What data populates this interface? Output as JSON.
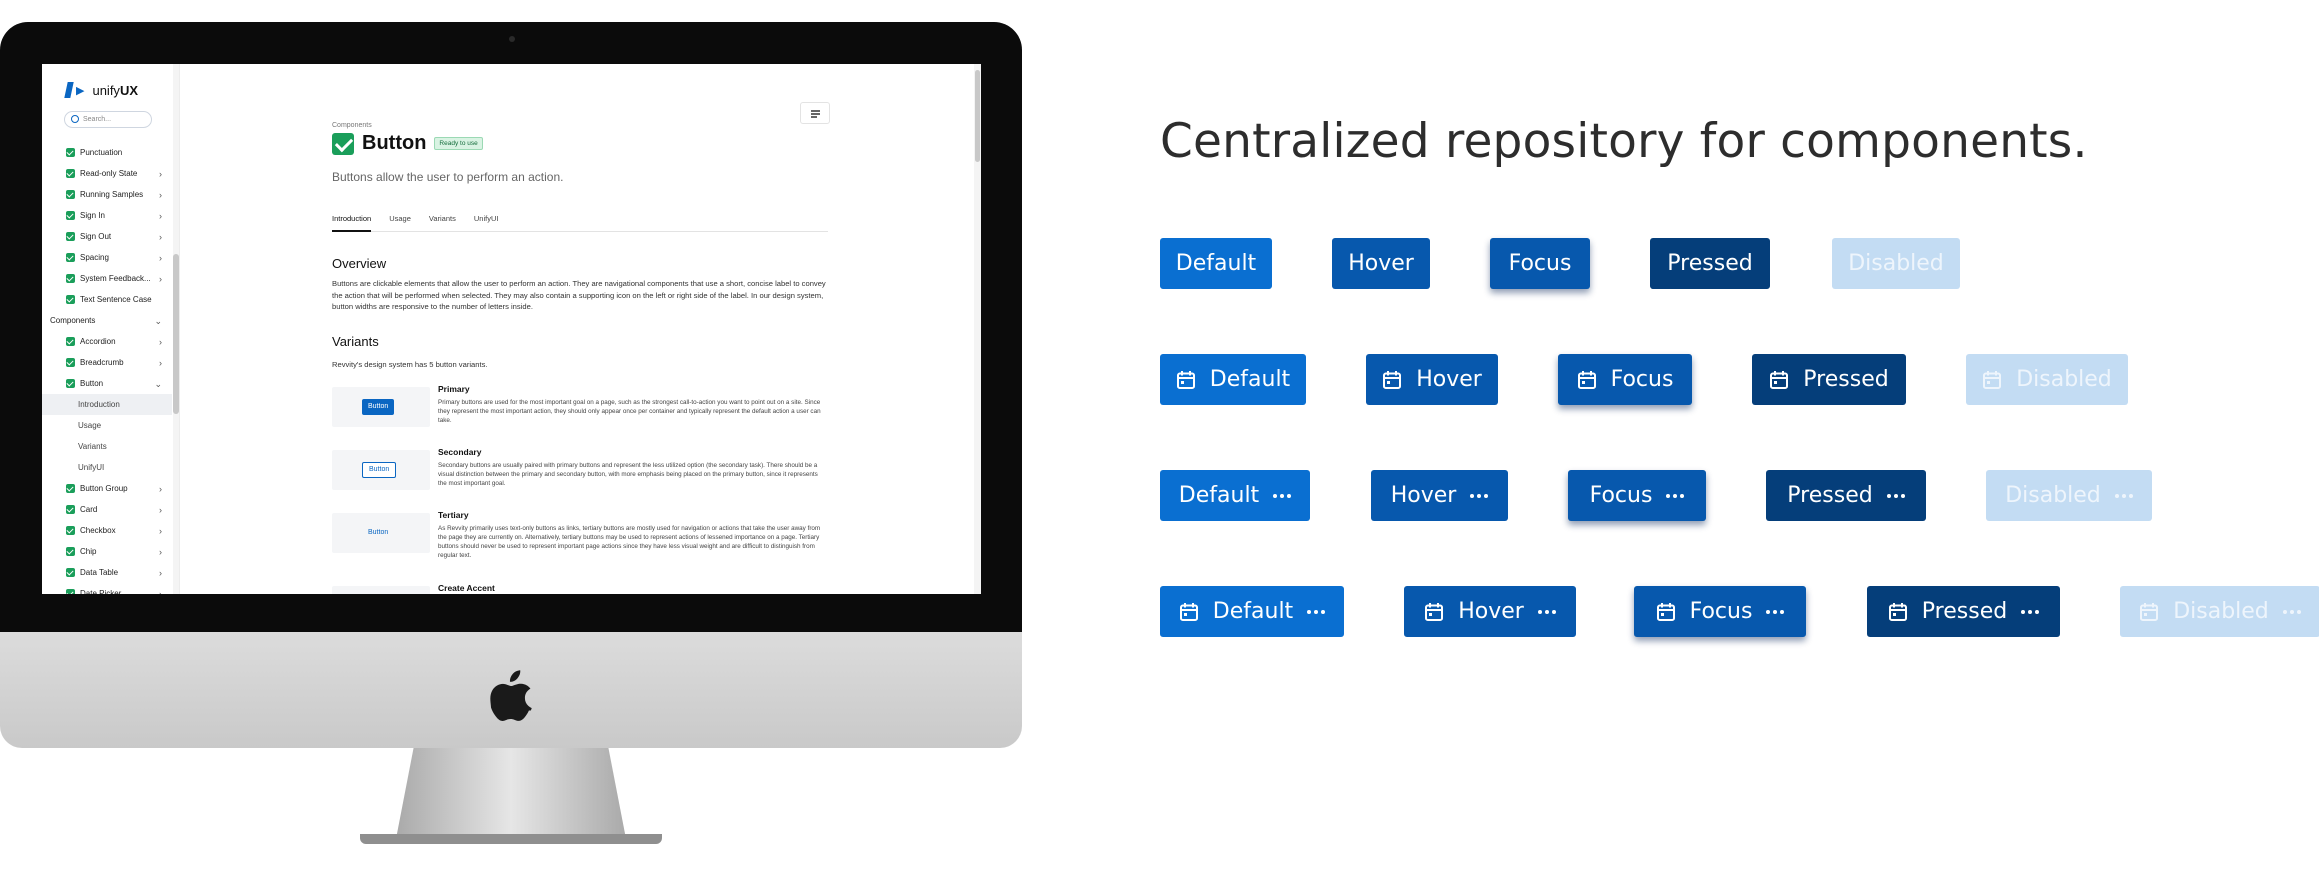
{
  "sidebar": {
    "logo_prefix": "unify",
    "logo_bold": "UX",
    "search_placeholder": "Search...",
    "items": [
      {
        "label": "Punctuation",
        "check": true,
        "chevron": false
      },
      {
        "label": "Read-only State",
        "check": true,
        "chevron": true
      },
      {
        "label": "Running Samples",
        "check": true,
        "chevron": true
      },
      {
        "label": "Sign In",
        "check": true,
        "chevron": true
      },
      {
        "label": "Sign Out",
        "check": true,
        "chevron": true
      },
      {
        "label": "Spacing",
        "check": true,
        "chevron": true
      },
      {
        "label": "System Feedback...",
        "check": true,
        "chevron": true
      },
      {
        "label": "Text Sentence Case",
        "check": true,
        "chevron": false
      },
      {
        "label": "Components",
        "section": true,
        "chevron": true
      },
      {
        "label": "Accordion",
        "check": true,
        "chevron": true
      },
      {
        "label": "Breadcrumb",
        "check": true,
        "chevron": true
      },
      {
        "label": "Button",
        "check": true,
        "chevron": true,
        "expanded": true
      },
      {
        "label": "Introduction",
        "sub": true,
        "active": true
      },
      {
        "label": "Usage",
        "sub": true
      },
      {
        "label": "Variants",
        "sub": true
      },
      {
        "label": "UnifyUI",
        "sub": true
      },
      {
        "label": "Button Group",
        "check": true,
        "chevron": true
      },
      {
        "label": "Card",
        "check": true,
        "chevron": true
      },
      {
        "label": "Checkbox",
        "check": true,
        "chevron": true
      },
      {
        "label": "Chip",
        "check": true,
        "chevron": true
      },
      {
        "label": "Data Table",
        "check": true,
        "chevron": true
      },
      {
        "label": "Date Picker",
        "check": true,
        "chevron": true
      }
    ]
  },
  "page": {
    "breadcrumb": "Components",
    "title": "Button",
    "badge": "Ready to use",
    "description": "Buttons allow the user to perform an action.",
    "tabs": [
      "Introduction",
      "Usage",
      "Variants",
      "UnifyUI"
    ],
    "overview_heading": "Overview",
    "overview_text": "Buttons are clickable elements that allow the user to perform an action. They are navigational components that use a short, concise label to convey the action that will be performed when selected. They may also contain a supporting icon on the left or right side of the label. In our design system, button widths are responsive to the number of letters inside.",
    "variants_heading": "Variants",
    "variants_intro": "Revvity's design system has 5 button variants.",
    "variants": [
      {
        "title": "Primary",
        "button": "Button",
        "text": "Primary buttons are used for the most important goal on a page, such as the strongest call-to-action you want to point out on a site. Since they represent the most important action, they should only appear once per container and typically represent the default action a user can take."
      },
      {
        "title": "Secondary",
        "button": "Button",
        "text": "Secondary buttons are usually paired with primary buttons and represent the less utilized option (the secondary task). There should be a visual distinction between the primary and secondary button, with more emphasis being placed on the primary button, since it represents the most important goal."
      },
      {
        "title": "Tertiary",
        "button": "Button",
        "text": "As Revvity primarily uses text-only buttons as links, tertiary buttons are mostly used for navigation or actions that take the user away from the page they are currently on. Alternatively, tertiary buttons may be used to represent actions of lessened importance on a page. Tertiary buttons should never be used to represent important page actions since they have less visual weight and are difficult to distinguish from regular text."
      },
      {
        "title": "Create Accent",
        "button": "",
        "text": ""
      }
    ]
  },
  "showcase": {
    "headline": "Centralized repository for components.",
    "states": [
      "Default",
      "Hover",
      "Focus",
      "Pressed",
      "Disabled"
    ],
    "colors": {
      "default": "#0a6fd1",
      "hover": "#0758ad",
      "focus": "#0758ad",
      "pressed": "#053e7a",
      "disabled": "#c3dcf3"
    },
    "rows": [
      {
        "leading_icon": null,
        "trailing_icon": null
      },
      {
        "leading_icon": "calendar-icon",
        "trailing_icon": null
      },
      {
        "leading_icon": null,
        "trailing_icon": "more-horizontal-icon"
      },
      {
        "leading_icon": "calendar-icon",
        "trailing_icon": "more-horizontal-icon"
      }
    ]
  }
}
